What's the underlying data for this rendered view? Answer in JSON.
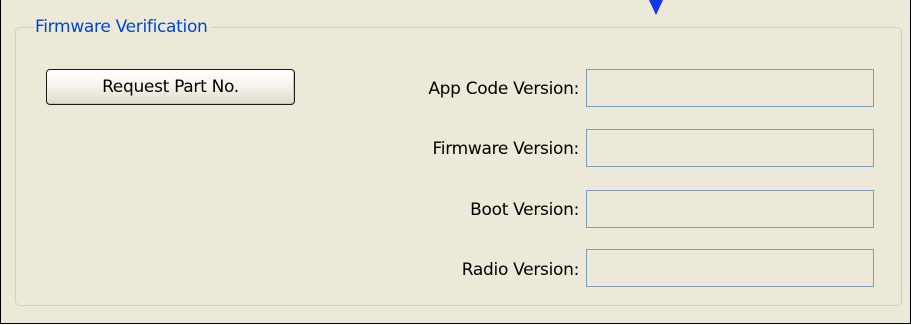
{
  "groupbox": {
    "title": "Firmware Verification"
  },
  "buttons": {
    "request_part_no": "Request Part No."
  },
  "fields": [
    {
      "label": "App Code Version:",
      "value": ""
    },
    {
      "label": "Firmware Version:",
      "value": ""
    },
    {
      "label": "Boot Version:",
      "value": ""
    },
    {
      "label": "Radio Version:",
      "value": ""
    }
  ],
  "colors": {
    "panel_background": "#ece9d8",
    "legend_text": "#0046d5",
    "field_border": "#7f9db9",
    "arrow": "#1036e8"
  },
  "icons": {
    "top_marker": "down-arrow-icon"
  }
}
